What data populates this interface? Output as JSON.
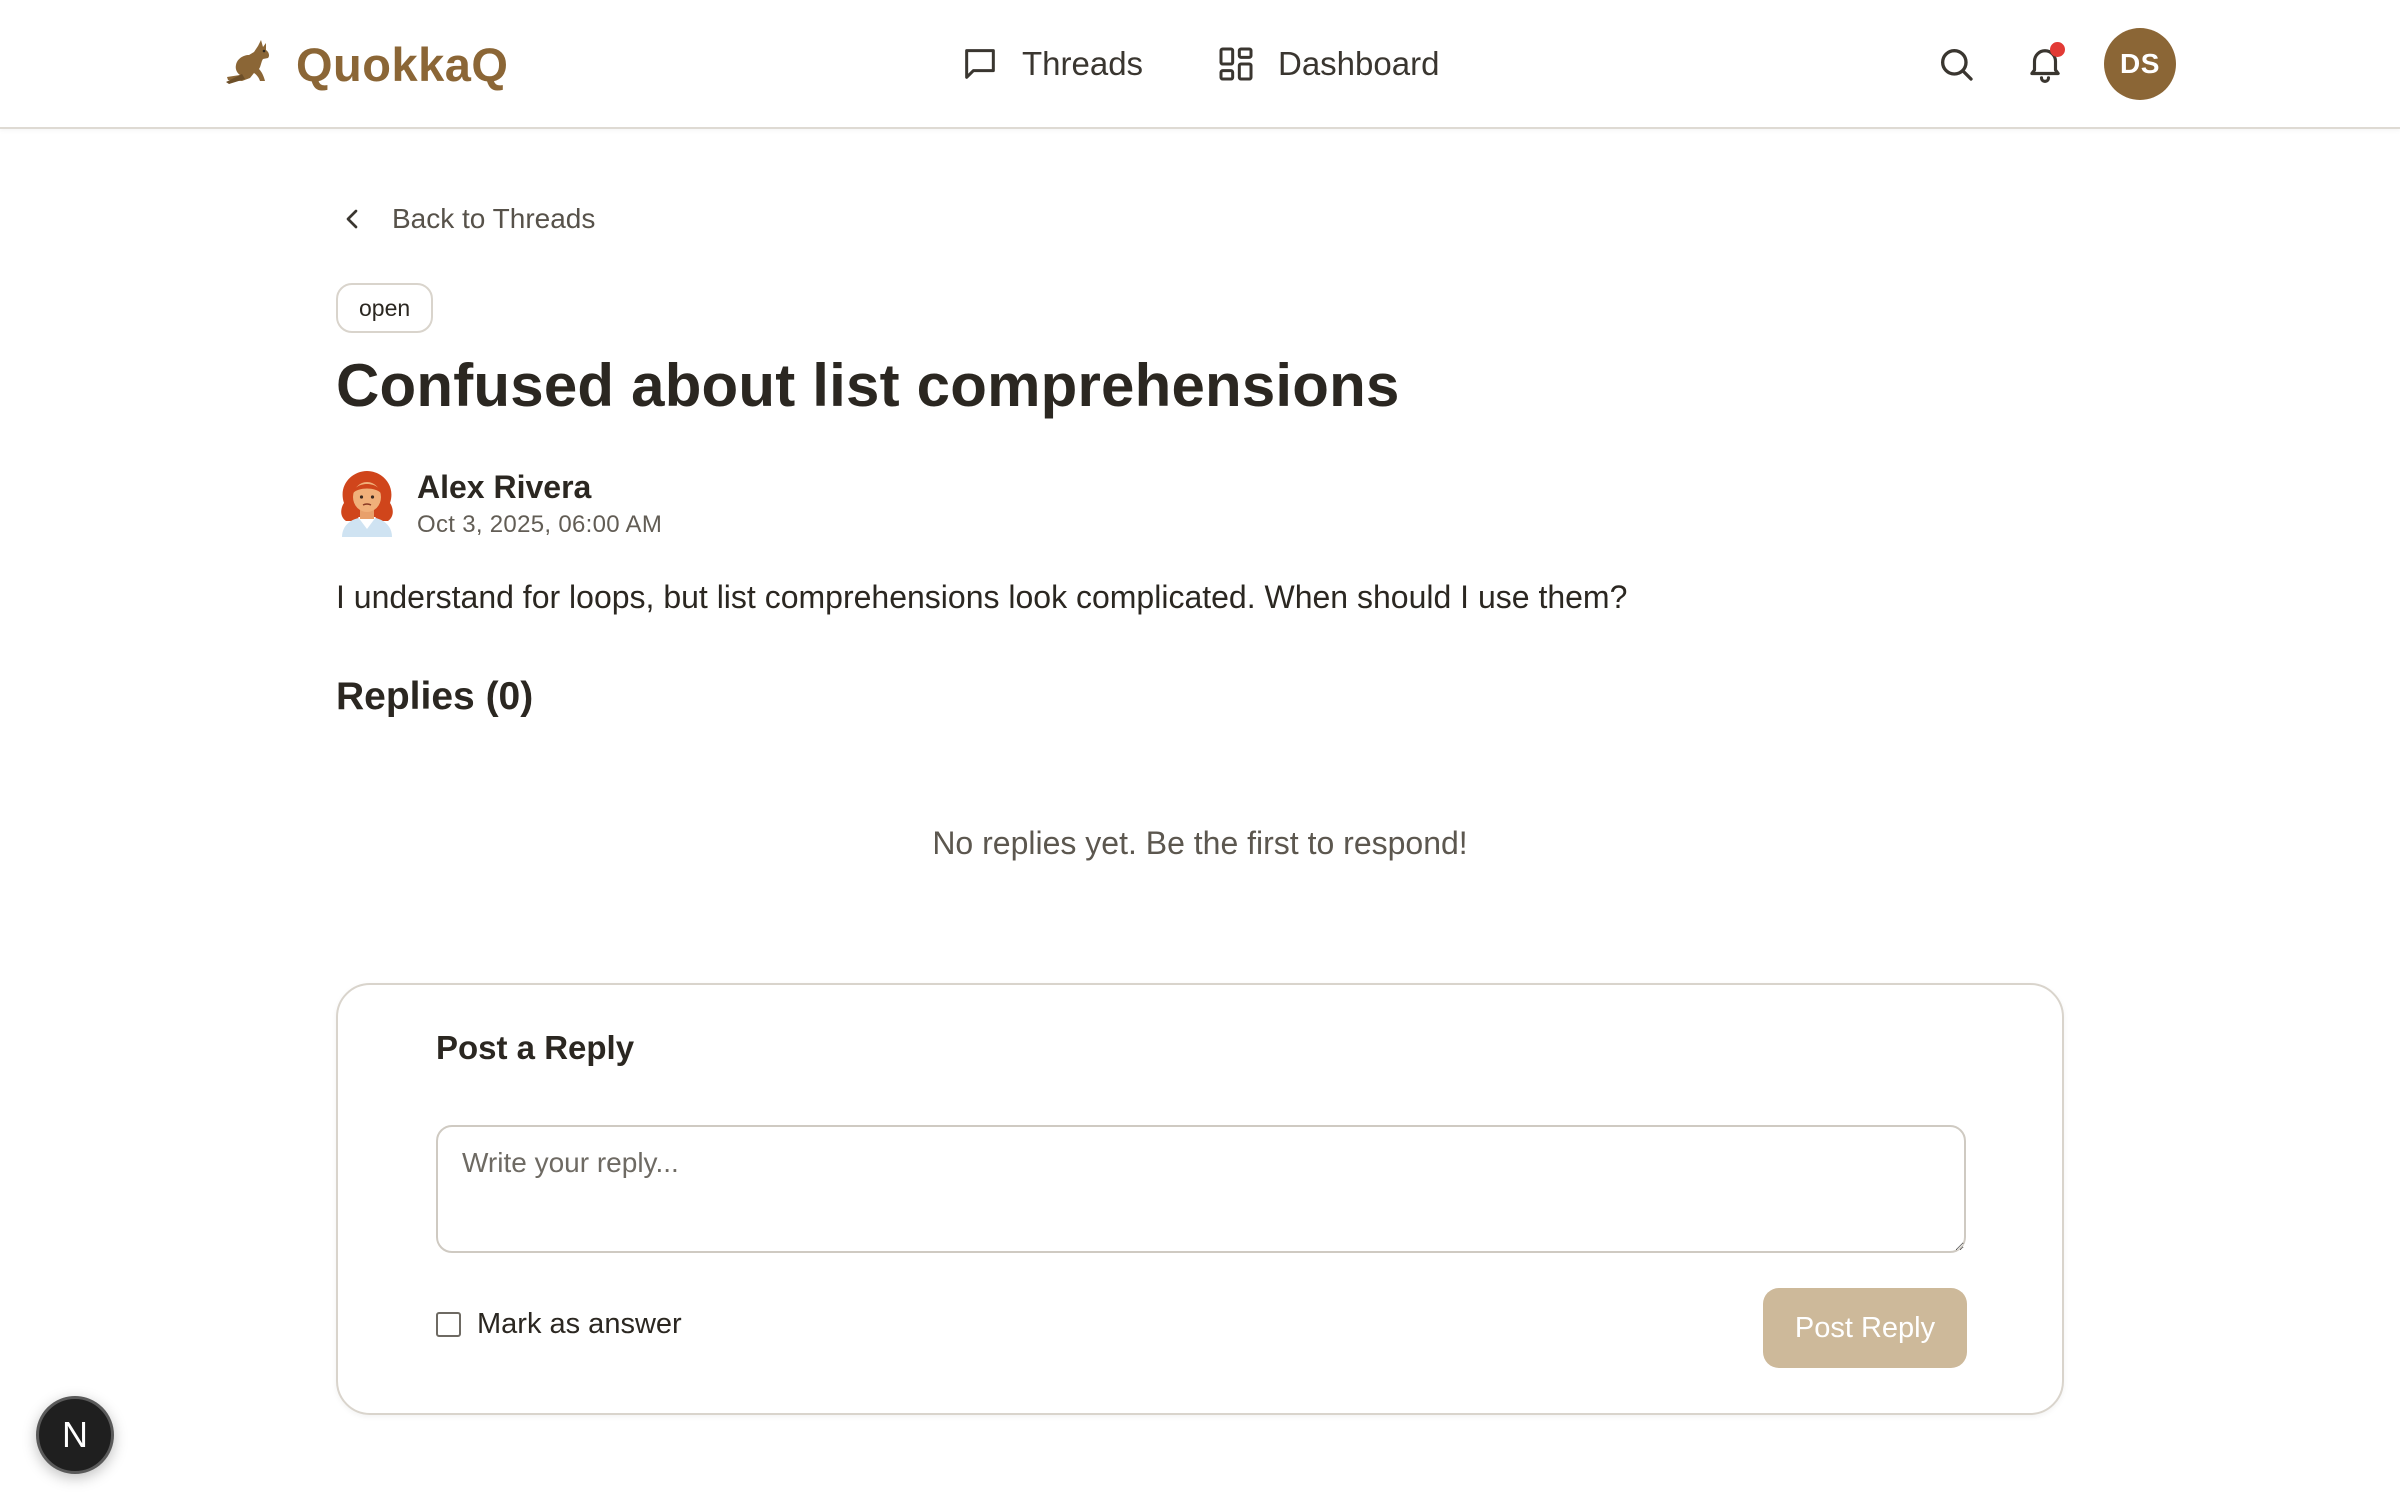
{
  "header": {
    "brand_name": "QuokkaQ",
    "nav": [
      {
        "label": "Threads",
        "icon": "chat-bubble-icon"
      },
      {
        "label": "Dashboard",
        "icon": "grid-icon"
      }
    ],
    "user_initials": "DS",
    "has_notification": true
  },
  "thread": {
    "back_label": "Back to Threads",
    "status": "open",
    "title": "Confused about list comprehensions",
    "author": "Alex Rivera",
    "date": "Oct 3, 2025, 06:00 AM",
    "body": "I understand for loops, but list comprehensions look complicated. When should I use them?"
  },
  "replies": {
    "heading": "Replies (0)",
    "empty_message": "No replies yet. Be the first to respond!"
  },
  "reply_form": {
    "title": "Post a Reply",
    "placeholder": "Write your reply...",
    "value": "",
    "mark_as_answer_label": "Mark as answer",
    "mark_as_answer_checked": false,
    "submit_label": "Post Reply"
  },
  "dev_badge": "N",
  "colors": {
    "brand": "#8b6636",
    "notification": "#e23a35",
    "button_disabled": "#cdb99a"
  }
}
